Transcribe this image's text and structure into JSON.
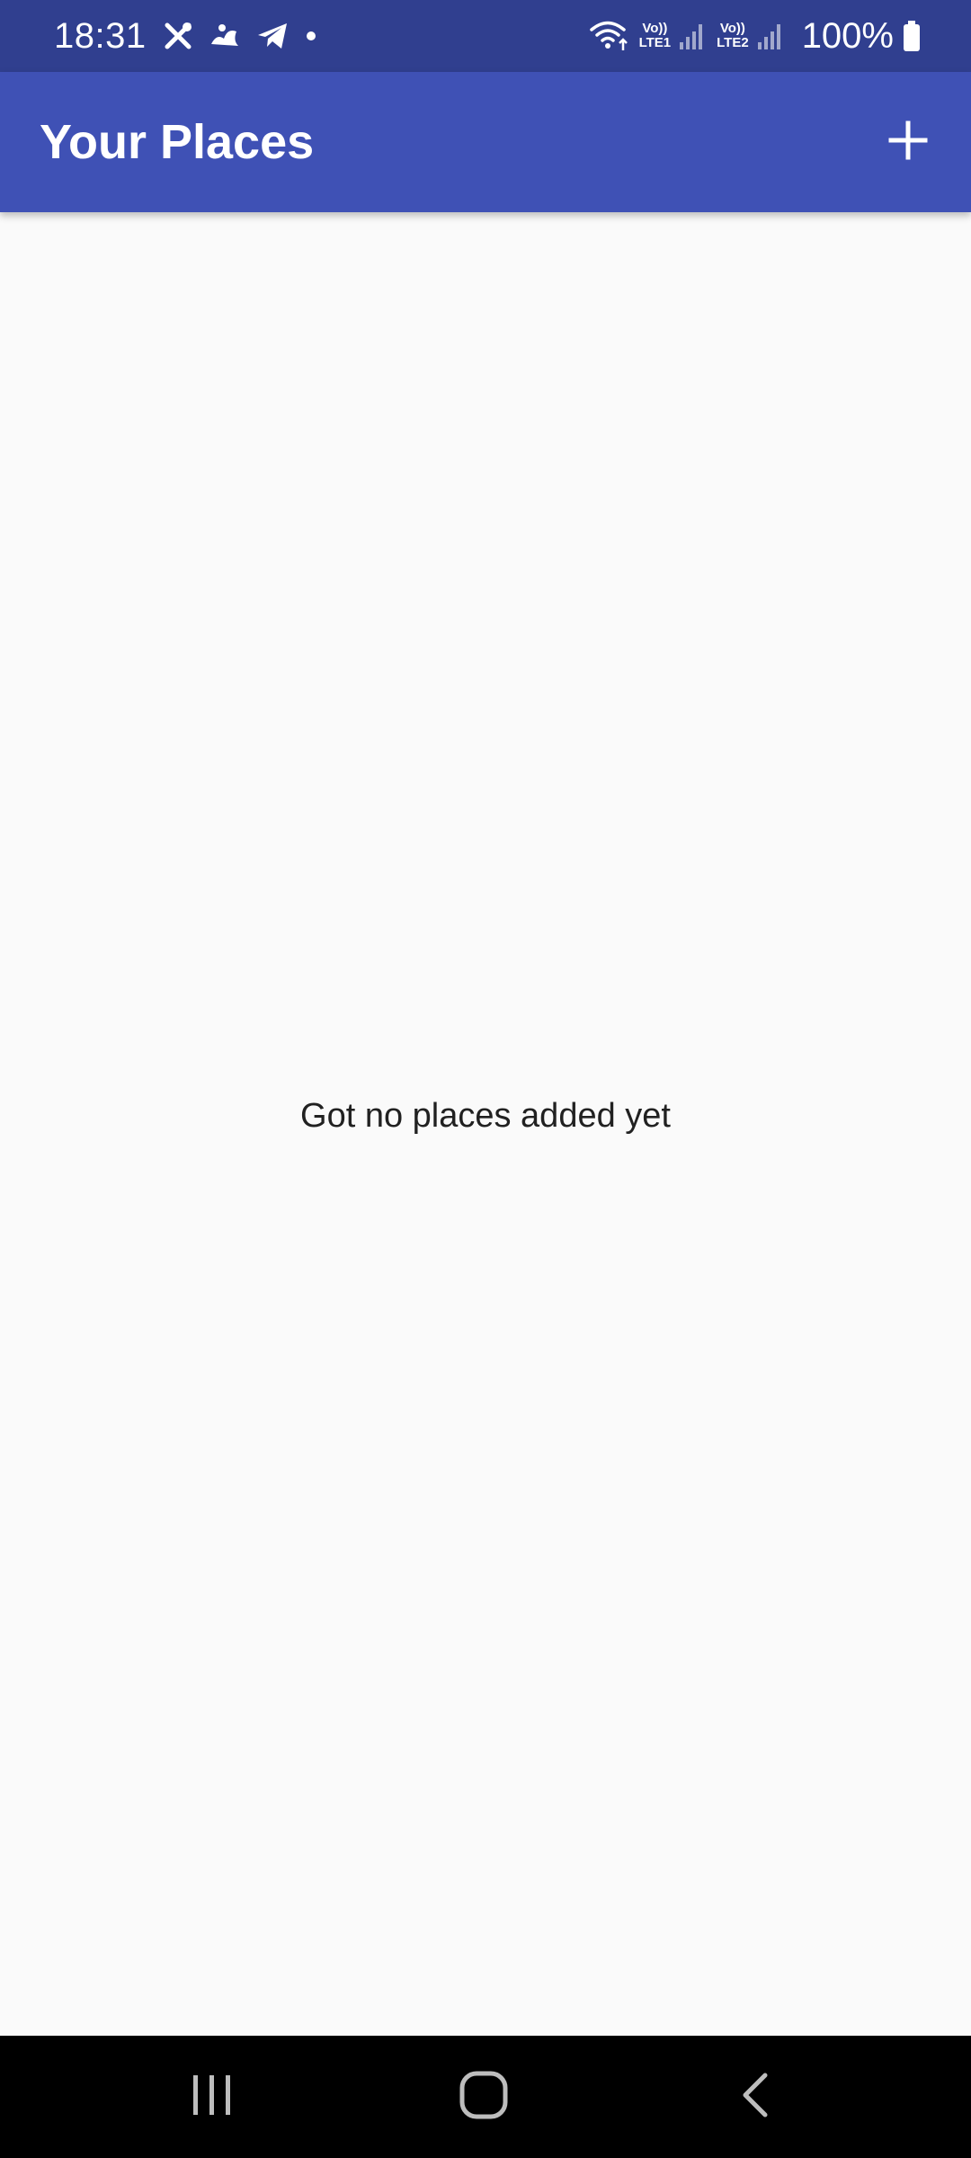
{
  "status_bar": {
    "time": "18:31",
    "lte1": {
      "top": "Vo))",
      "bottom": "LTE1"
    },
    "lte2": {
      "top": "Vo))",
      "bottom": "LTE2"
    },
    "battery_percent": "100%"
  },
  "app_bar": {
    "title": "Your Places",
    "add_icon": "plus-icon"
  },
  "main": {
    "empty_message": "Got no places added yet"
  },
  "nav_bar": {
    "recents_icon": "recents-icon",
    "home_icon": "home-icon",
    "back_icon": "back-icon"
  },
  "colors": {
    "status_bar": "#303f8f",
    "app_bar": "#3f51b5",
    "background": "#fafafa",
    "text": "#212121",
    "nav_bar": "#000000"
  }
}
